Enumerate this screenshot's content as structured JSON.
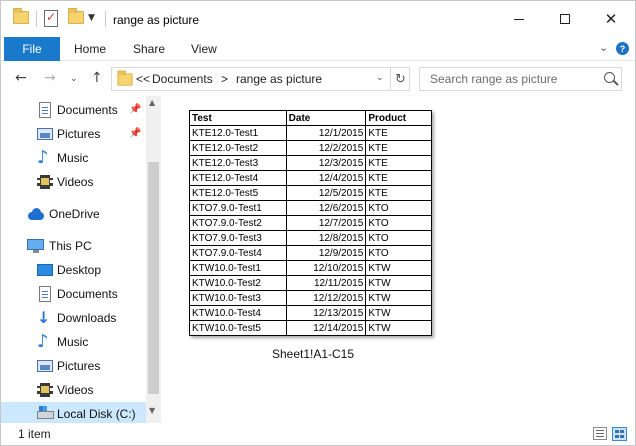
{
  "window": {
    "title": "range as picture"
  },
  "ribbon": {
    "file": "File",
    "tabs": [
      "Home",
      "Share",
      "View"
    ]
  },
  "address": {
    "overflow": "<<",
    "crumbs": [
      "Documents",
      "range as picture"
    ],
    "separator": ">"
  },
  "search": {
    "placeholder": "Search range as picture"
  },
  "nav": {
    "items": [
      {
        "label": "Documents",
        "icon": "documents-icon",
        "pinned": true
      },
      {
        "label": "Pictures",
        "icon": "pictures-icon",
        "pinned": true
      },
      {
        "label": "Music",
        "icon": "music-icon"
      },
      {
        "label": "Videos",
        "icon": "videos-icon"
      },
      {
        "label": "OneDrive",
        "icon": "onedrive-icon"
      },
      {
        "label": "This PC",
        "icon": "this-pc-icon"
      },
      {
        "label": "Desktop",
        "icon": "desktop-icon"
      },
      {
        "label": "Documents",
        "icon": "documents-icon"
      },
      {
        "label": "Downloads",
        "icon": "downloads-icon"
      },
      {
        "label": "Music",
        "icon": "music-icon"
      },
      {
        "label": "Pictures",
        "icon": "pictures-icon"
      },
      {
        "label": "Videos",
        "icon": "videos-icon"
      },
      {
        "label": "Local Disk (C:)",
        "icon": "local-disk-icon",
        "selected": true
      }
    ]
  },
  "file": {
    "name": "Sheet1!A1-C15",
    "thumbnail": {
      "headers": [
        "Test",
        "Date",
        "Product"
      ],
      "rows": [
        [
          "KTE12.0-Test1",
          "12/1/2015",
          "KTE"
        ],
        [
          "KTE12.0-Test2",
          "12/2/2015",
          "KTE"
        ],
        [
          "KTE12.0-Test3",
          "12/3/2015",
          "KTE"
        ],
        [
          "KTE12.0-Test4",
          "12/4/2015",
          "KTE"
        ],
        [
          "KTE12.0-Test5",
          "12/5/2015",
          "KTE"
        ],
        [
          "KTO7.9.0-Test1",
          "12/6/2015",
          "KTO"
        ],
        [
          "KTO7.9.0-Test2",
          "12/7/2015",
          "KTO"
        ],
        [
          "KTO7.9.0-Test3",
          "12/8/2015",
          "KTO"
        ],
        [
          "KTO7.9.0-Test4",
          "12/9/2015",
          "KTO"
        ],
        [
          "KTW10.0-Test1",
          "12/10/2015",
          "KTW"
        ],
        [
          "KTW10.0-Test2",
          "12/11/2015",
          "KTW"
        ],
        [
          "KTW10.0-Test3",
          "12/12/2015",
          "KTW"
        ],
        [
          "KTW10.0-Test4",
          "12/13/2015",
          "KTW"
        ],
        [
          "KTW10.0-Test5",
          "12/14/2015",
          "KTW"
        ]
      ]
    }
  },
  "status": {
    "count": "1 item"
  },
  "colors": {
    "file_tab": "#1979ca",
    "selection": "#cce8ff",
    "folder": "#f6d46d"
  }
}
